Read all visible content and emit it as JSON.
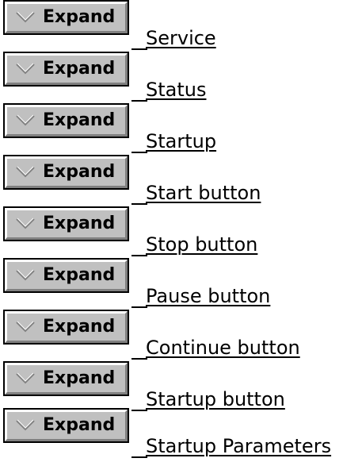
{
  "topics": {
    "expand_label": "Expand",
    "expand_icon": "chevron-down-icon",
    "items": [
      {
        "label": "Service"
      },
      {
        "label": "Status"
      },
      {
        "label": "Startup"
      },
      {
        "label": "Start button"
      },
      {
        "label": "Stop button"
      },
      {
        "label": "Pause button"
      },
      {
        "label": "Continue button"
      },
      {
        "label": "Startup button"
      },
      {
        "label": "Startup Parameters"
      }
    ]
  }
}
